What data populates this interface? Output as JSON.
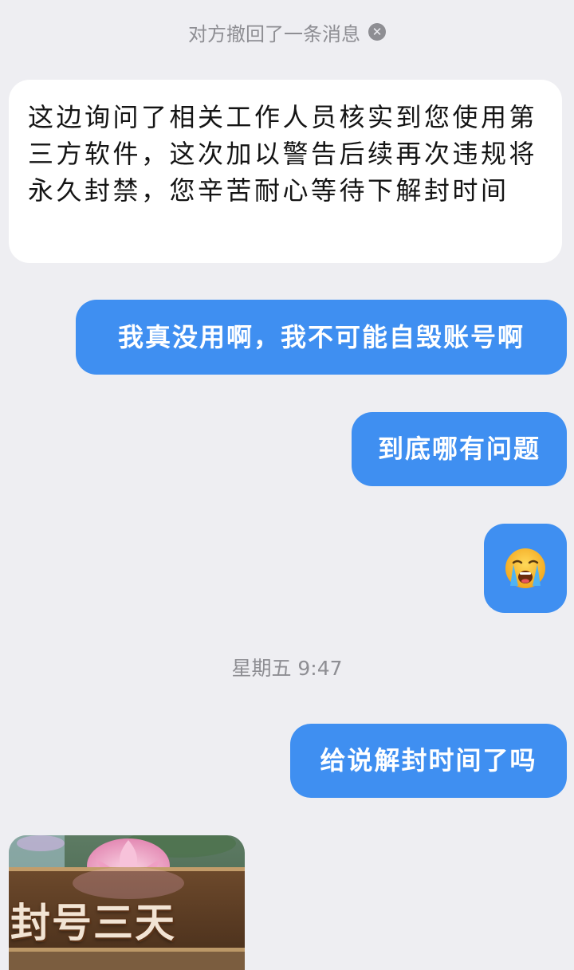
{
  "system_notice": {
    "text": "对方撤回了一条消息",
    "icon": "close-circle-icon"
  },
  "messages": {
    "incoming_1": "这边询问了相关工作人员核实到您使用第三方软件，这次加以警告后续再次违规将永久封禁，您辛苦耐心等待下解封时间",
    "outgoing_1": "我真没用啊，我不可能自毁账号啊",
    "outgoing_2": "到底哪有问题",
    "outgoing_3_emoji": "loudly-crying-face",
    "outgoing_4": "给说解封时间了吗"
  },
  "time_divider": "星期五 9:47",
  "image_message": {
    "caption": "封号三天"
  },
  "colors": {
    "background": "#eeeef2",
    "incoming_bubble": "#ffffff",
    "outgoing_bubble": "#3f8ff1",
    "system_text": "#8e8e93"
  }
}
